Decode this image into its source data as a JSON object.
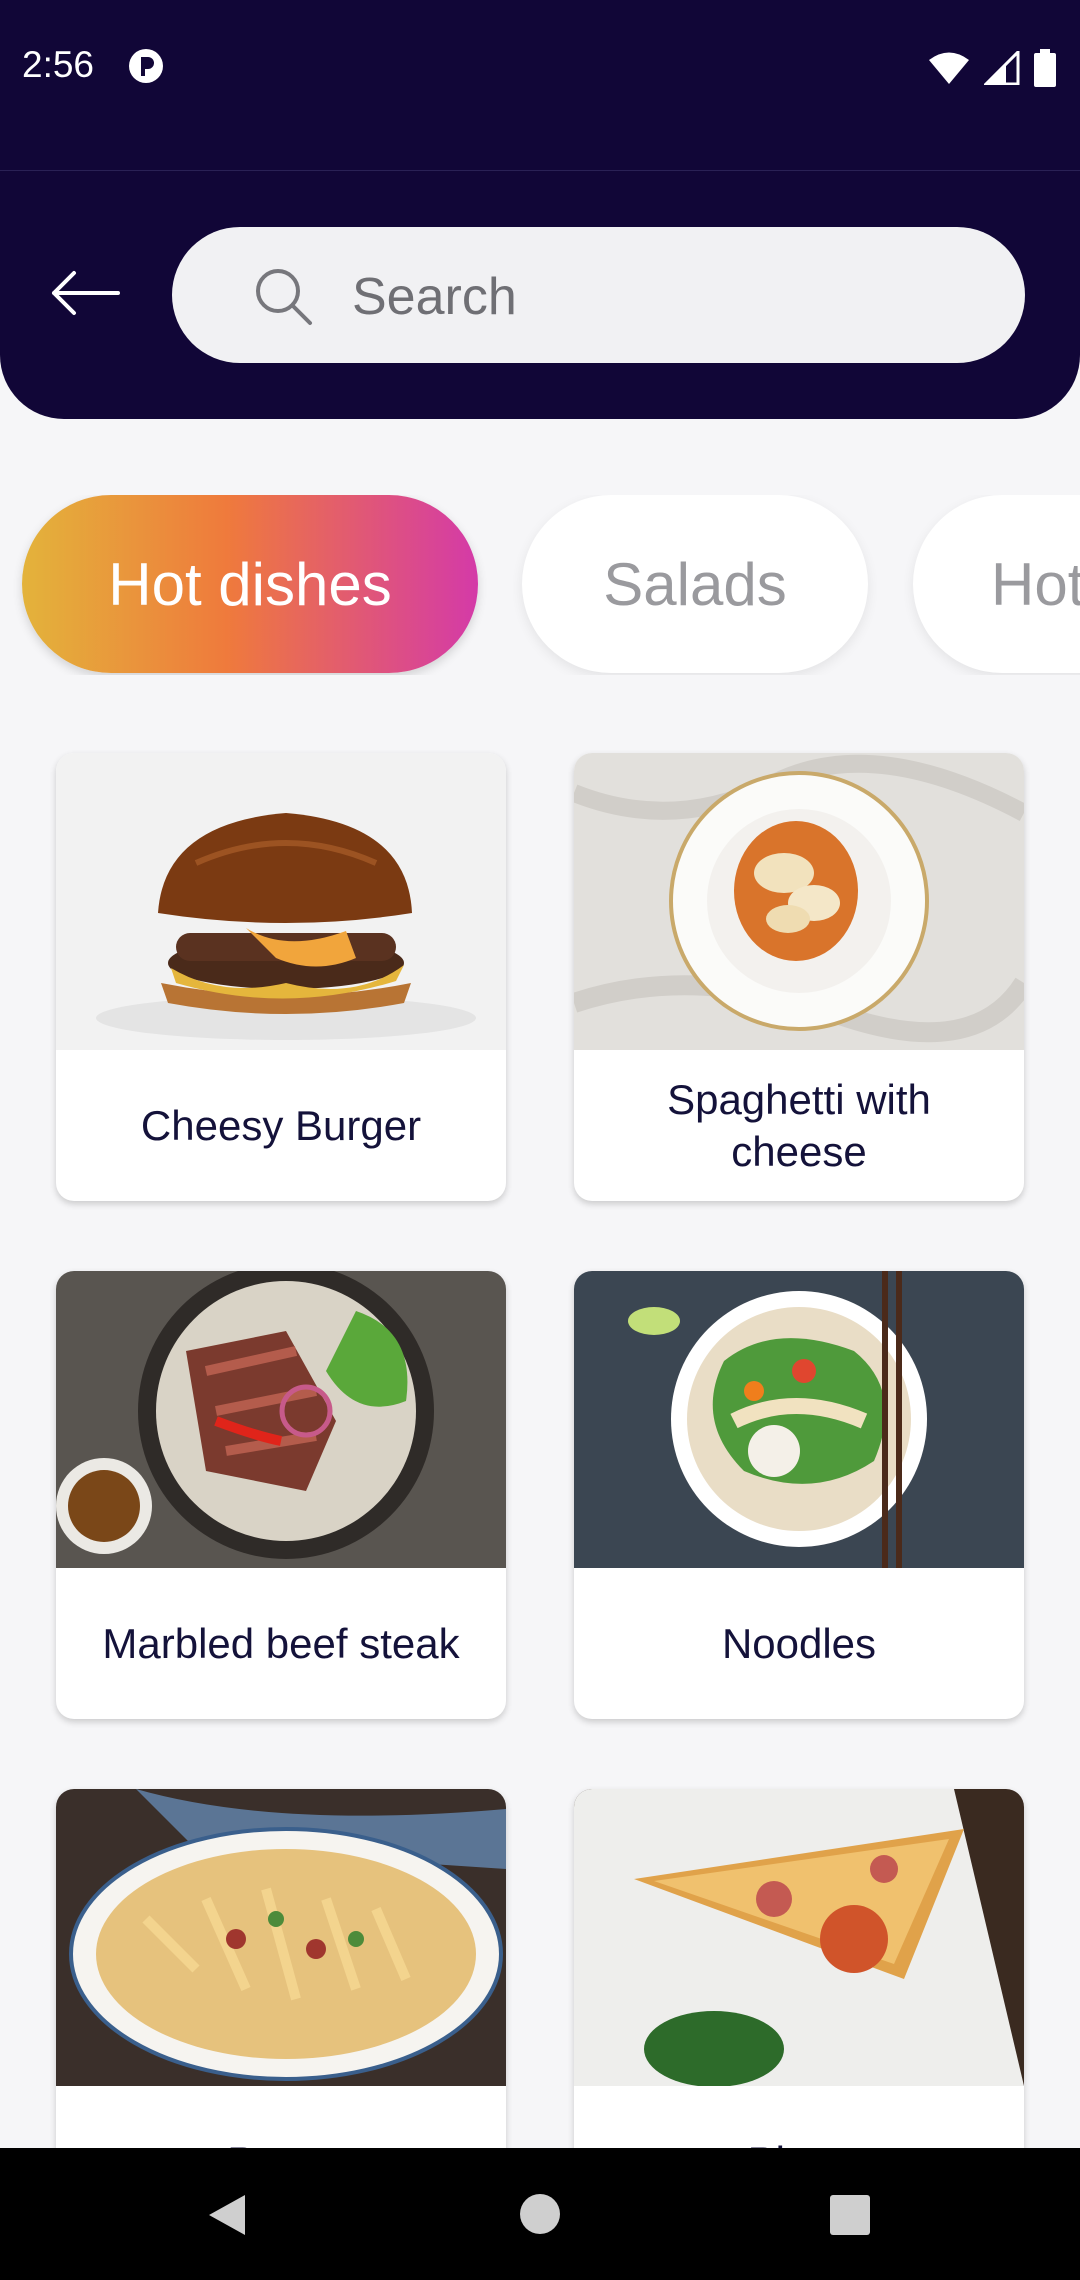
{
  "status_bar": {
    "time": "2:56"
  },
  "search": {
    "placeholder": "Search"
  },
  "categories": [
    "Hot dishes",
    "Salads",
    "Hot"
  ],
  "dishes": [
    {
      "name": "Cheesy Burger"
    },
    {
      "name": "Spaghetti with cheese"
    },
    {
      "name": "Marbled beef steak"
    },
    {
      "name": "Noodles"
    },
    {
      "name": "Pasta"
    },
    {
      "name": "Pizza"
    }
  ],
  "colors": {
    "header_bg": "#110637",
    "chip_gradient_start": "#e3b33b",
    "chip_gradient_end": "#d43aa8",
    "text_dark": "#14123a"
  }
}
